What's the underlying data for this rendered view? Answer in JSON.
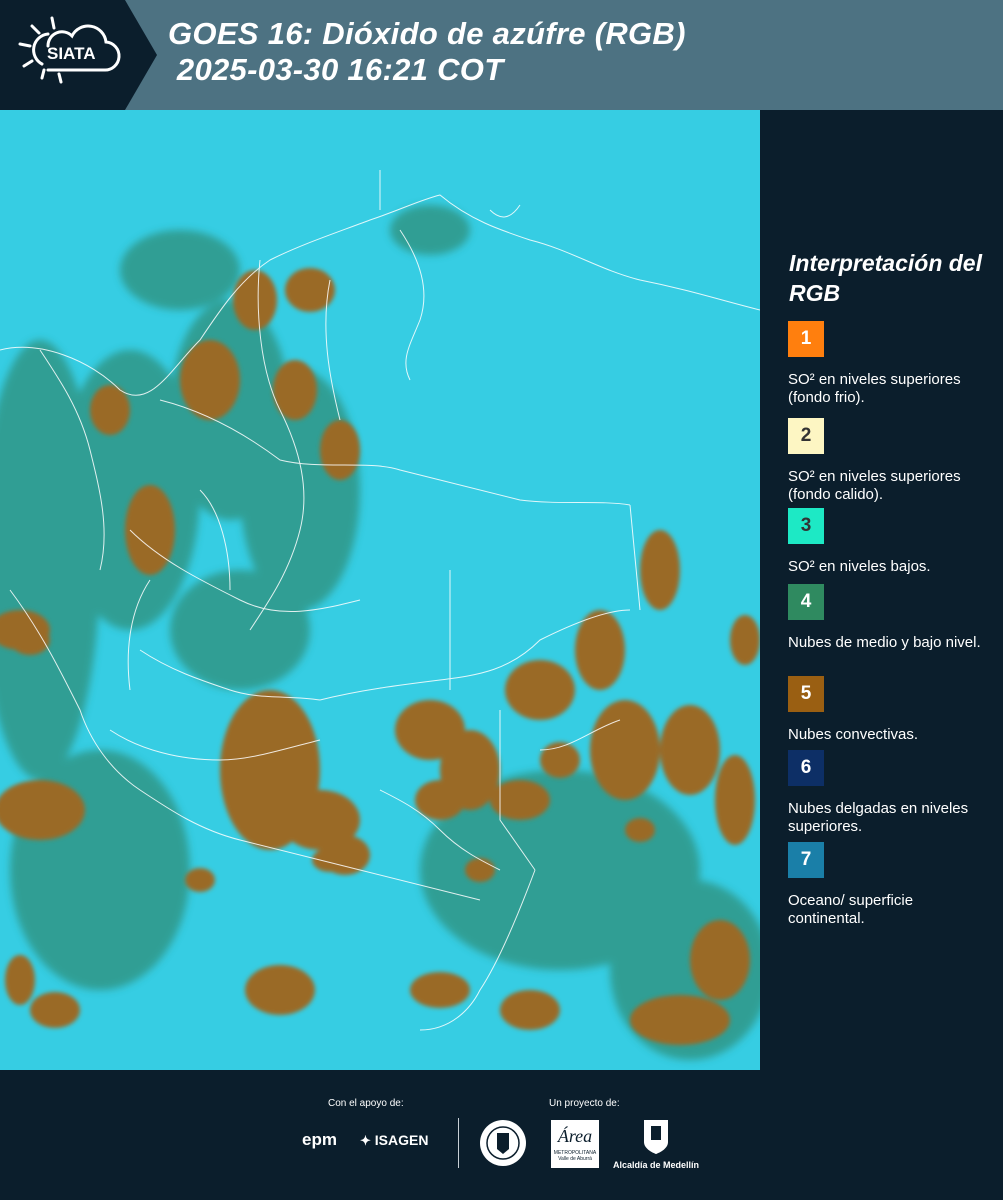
{
  "header": {
    "logo_text": "SIATA",
    "title_line1": "GOES 16: Dióxido de azúfre (RGB)",
    "title_line2": " 2025-03-30 16:21 COT"
  },
  "legend": {
    "title": "Interpretación del RGB",
    "items": [
      {
        "number": "1",
        "color": "#ff7f0e",
        "text": "SO² en niveles superiores (fondo frio)."
      },
      {
        "number": "2",
        "color": "#fdf6c3",
        "text": "SO² en niveles superiores (fondo calido)."
      },
      {
        "number": "3",
        "color": "#1de9c5",
        "text": "SO² en niveles bajos."
      },
      {
        "number": "4",
        "color": "#2f8a60",
        "text": "Nubes de medio y bajo nivel."
      },
      {
        "number": "5",
        "color": "#9a5f12",
        "text": "Nubes convectivas."
      },
      {
        "number": "6",
        "color": "#0d2f66",
        "text": "Nubes delgadas en niveles superiores."
      },
      {
        "number": "7",
        "color": "#1a7fa8",
        "text": "Oceano/ superficie continental."
      }
    ]
  },
  "footer": {
    "support_label": "Con el apoyo de:",
    "project_label": "Un proyecto de:",
    "logos": {
      "epm": "epm",
      "isagen": "ISAGEN",
      "area_name": "Área",
      "area_sub": "METROPOLITANA",
      "area_sub2": "Valle de Aburrá",
      "alcaldia": "Alcaldía de Medellín"
    }
  },
  "colors": {
    "background": "#0b1e2c",
    "header": "#4d7282",
    "map_base": "#35cfe3",
    "cloud": "#9a6a28"
  },
  "icons": [
    "siata-logo-icon",
    "sun-cloud-icon",
    "epm-logo",
    "isagen-logo",
    "medellin-seal-icon",
    "area-metropolitana-logo",
    "alcaldia-medellin-logo"
  ]
}
